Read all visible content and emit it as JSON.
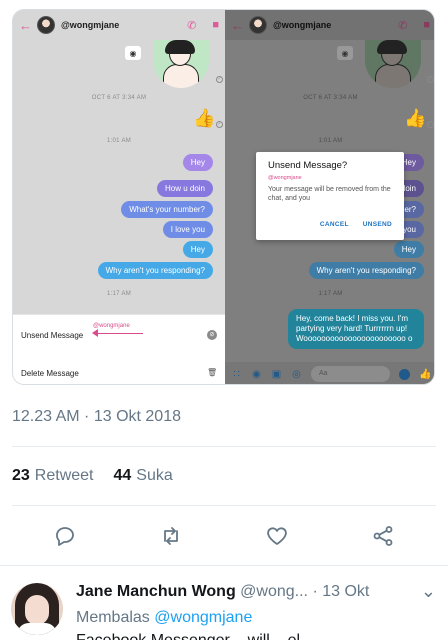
{
  "screenshot": {
    "username": "@wongmjane",
    "icons": {
      "back": "back-arrow-icon",
      "call": "phone-icon",
      "video": "video-icon",
      "camera": "camera-icon",
      "like": "thumbs-up-icon"
    },
    "timestamp_1": "OCT 6 AT 3:34 AM",
    "timestamp_2": "1:01 AM",
    "timestamp_3": "1:17 AM",
    "messages": [
      "Hey",
      "How u doin",
      "What's your number?",
      "I love you",
      "Hey",
      "Why aren't you responding?"
    ],
    "long_message": "Hey, come back! I miss you. I'm partying very hard! Turrrrrrn up! Wooooooooooooooooooooooo o",
    "sheet": {
      "unsend_label": "Unsend Message",
      "delete_label": "Delete Message",
      "annotation": "@wongmjane"
    },
    "dialog": {
      "title": "Unsend Message?",
      "tag": "@wongmjane",
      "body": "Your message will be removed from the chat, and you",
      "cancel": "CANCEL",
      "unsend": "UNSEND"
    },
    "composer": {
      "placeholder": "Aa"
    }
  },
  "tweet": {
    "time": "12.23 AM · 13 Okt 2018",
    "retweet_count": "23",
    "retweet_label": "Retweet",
    "like_count": "44",
    "like_label": "Suka"
  },
  "reply": {
    "name": "Jane Manchun Wong",
    "handle": "@wong...",
    "date": "· 13 Okt",
    "replying_label": "Membalas",
    "replying_to": "@wongmjane",
    "text": "Facebook Messenger ...will ...el..."
  }
}
